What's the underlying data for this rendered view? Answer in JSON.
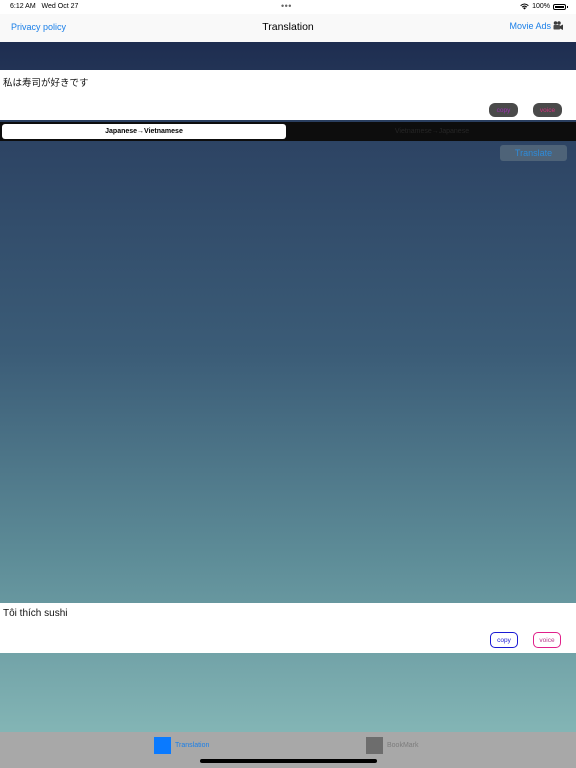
{
  "status_bar": {
    "time": "6:12 AM",
    "date": "Wed Oct 27",
    "dots": "•••",
    "battery": "100%"
  },
  "nav": {
    "left_label": "Privacy policy",
    "title": "Translation",
    "right_label": "Movie Ads"
  },
  "input": {
    "text": "私は寿司が好きです",
    "copy_label": "copy",
    "voice_label": "voice"
  },
  "segments": {
    "active": "Japanese→Vietnamese",
    "inactive": "Vietnamese→Japanese"
  },
  "translate_label": "Translate",
  "output": {
    "text": "Tôi thích sushi",
    "copy_label": "copy",
    "voice_label": "voice"
  },
  "tabs": [
    {
      "label": "Translation",
      "selected": true
    },
    {
      "label": "BookMark",
      "selected": false
    }
  ],
  "colors": {
    "accent": "#1a7fe8",
    "tab_active": "#0a7aff",
    "copy_border": "#1a1ad4",
    "voice_border": "#e0208a"
  }
}
